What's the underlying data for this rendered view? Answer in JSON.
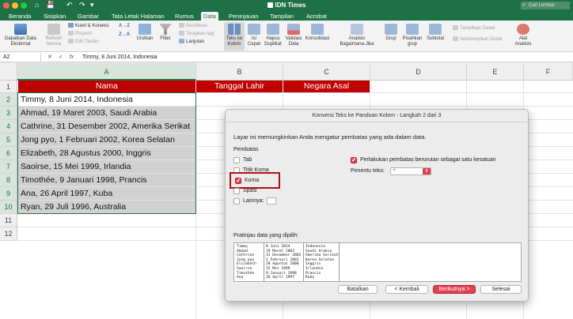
{
  "titlebar": {
    "title": "IDN Times",
    "search_placeholder": "Cari Lembar",
    "quick_access": [
      "⌂",
      "💾",
      "↶",
      "↷",
      "▾"
    ]
  },
  "tabs": [
    "Beranda",
    "Sisipkan",
    "Gambar",
    "Tata Letak Halaman",
    "Rumus",
    "Data",
    "Peninjauan",
    "Tampilan",
    "Acrobat"
  ],
  "active_tab": "Data",
  "ribbon": {
    "get_external_data": "Dapatkan Data Eksternal",
    "refresh_all": "Refresh Semua",
    "queries_connections": "Kueri & Koneksi",
    "properties": "Properti",
    "edit_links": "Edit Tautan",
    "sort_asc": "A→Z",
    "sort_desc": "Z→A",
    "sort": "Urutkan",
    "filter": "Filter",
    "clear": "Bersihkan",
    "reapply": "Terapkan lagi",
    "advanced": "Lanjutan",
    "text_to_columns": "Teks ke Kolom",
    "flash_fill": "Isi Cepat",
    "remove_duplicates": "Hapus Duplikat",
    "data_validation": "Validasi Data",
    "consolidate": "Konsolidasi",
    "what_if": "Analisis Bagaimana-Jika",
    "group": "Grup",
    "ungroup": "Pisahkan grup",
    "subtotal": "Subtotal",
    "show_detail": "Tampilkan Detail",
    "hide_detail": "Sembunyikan Detail",
    "analysis_tools": "Alat Analisis"
  },
  "formula_bar": {
    "cell_ref": "A2",
    "fx": "fx",
    "content": "Timmy, 8 Juni 2014, Indonesia"
  },
  "columns": [
    "A",
    "B",
    "C",
    "D",
    "E",
    "F"
  ],
  "rows": [
    "1",
    "2",
    "3",
    "4",
    "5",
    "6",
    "7",
    "8",
    "9",
    "10",
    "11",
    "12"
  ],
  "sheet": {
    "headers": [
      "Nama",
      "Tanggal Lahir",
      "Negara Asal"
    ],
    "data": [
      "Timmy, 8 Juni 2014, Indonesia",
      "Ahmad, 19 Maret 2003, Saudi Arabia",
      "Cathrine, 31 Desember 2002, Amerika Serikat",
      "Jong pyo, 1 Februari 2002, Korea Selatan",
      "Elizabeth, 28 Agustus 2000, Inggris",
      "Saoirse, 15 Mei 1999, Irlandia",
      "Timothée, 9 Januari 1998, Prancis",
      "Ana, 26 April 1997, Kuba",
      "Ryan, 29 Juli 1996, Australia"
    ]
  },
  "dialog": {
    "title": "Konversi Teks ke Panduan Kolom - Langkah 2 dari 3",
    "intro": "Layar ini memungkinkan Anda mengatur pembatas yang ada dalam data.",
    "delimiters_label": "Pembatas",
    "tab": "Tab",
    "semicolon": "Titik Koma",
    "comma": "Koma",
    "space": "Spasi",
    "other": "Lainnya:",
    "consecutive": "Perlakukan pembatas berurutan sebagai satu kesatuan",
    "text_qualifier_label": "Penentu teks:",
    "text_qualifier_value": "\"",
    "preview_label": "Pratinjau data yang dipilih:",
    "preview_col1": [
      "Timmy",
      "Ahmad",
      "Cathrine",
      "Jong pyo",
      "Elizabeth",
      "Saoirse",
      "Timothée",
      "Ana"
    ],
    "preview_col2": [
      "8 Juni 2014",
      "19 Maret 2003",
      "31 Desember 2002",
      "1 Februari 2002",
      "28 Agustus 2000",
      "15 Mei 1999",
      "9 Januari 1998",
      "26 April 1997"
    ],
    "preview_col3": [
      "Indonesia",
      "Saudi Arabia",
      "Amerika Serikat",
      "Korea Selatan",
      "Inggris",
      "Irlandia",
      "Prancis",
      "Kuba"
    ],
    "cancel": "Batalkan",
    "back": "< Kembali",
    "next": "Berikutnya >",
    "finish": "Selesai"
  },
  "colors": {
    "excel_green": "#1e7145",
    "header_red": "#c00000",
    "accent_red": "#e04050",
    "highlight_red": "#b01010"
  }
}
